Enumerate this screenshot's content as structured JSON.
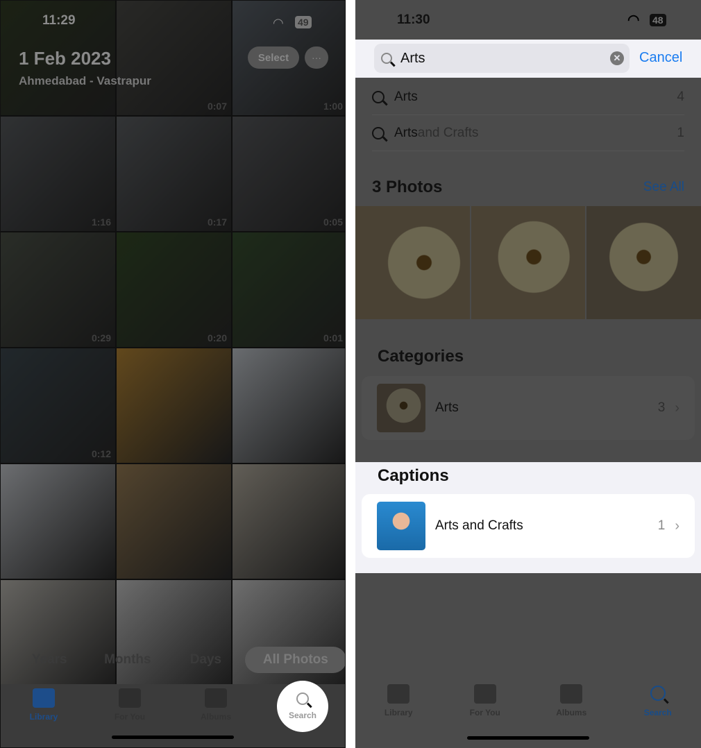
{
  "left": {
    "status": {
      "time": "11:29",
      "battery": "49"
    },
    "header": {
      "date": "1 Feb 2023",
      "location": "Ahmedabad - Vastrapur",
      "select_label": "Select",
      "more_label": "···"
    },
    "tiles": [
      {
        "duration": ""
      },
      {
        "duration": "0:07"
      },
      {
        "duration": "1:00"
      },
      {
        "duration": "1:16"
      },
      {
        "duration": "0:17"
      },
      {
        "duration": "0:05"
      },
      {
        "duration": "0:29"
      },
      {
        "duration": "0:20"
      },
      {
        "duration": "0:01"
      },
      {
        "duration": "0:12"
      },
      {
        "duration": ""
      },
      {
        "duration": ""
      },
      {
        "duration": ""
      },
      {
        "duration": ""
      },
      {
        "duration": ""
      },
      {
        "duration": ""
      },
      {
        "duration": ""
      },
      {
        "duration": ""
      }
    ],
    "segments": [
      "Years",
      "Months",
      "Days",
      "All Photos"
    ],
    "tabs": [
      "Library",
      "For You",
      "Albums",
      "Search"
    ]
  },
  "right": {
    "status": {
      "time": "11:30",
      "battery": "48"
    },
    "search": {
      "value": "Arts",
      "cancel_label": "Cancel"
    },
    "suggestions": [
      {
        "label": "Arts",
        "suffix": "",
        "count": "4"
      },
      {
        "label": "Arts",
        "suffix": " and Crafts",
        "count": "1"
      }
    ],
    "photos": {
      "title": "3 Photos",
      "see_all": "See All"
    },
    "categories": {
      "title": "Categories",
      "items": [
        {
          "label": "Arts",
          "count": "3"
        }
      ]
    },
    "captions": {
      "title": "Captions",
      "items": [
        {
          "label": "Arts and Crafts",
          "count": "1"
        }
      ]
    },
    "tabs": [
      "Library",
      "For You",
      "Albums",
      "Search"
    ]
  },
  "colors": {
    "accent": "#1a7cf0",
    "dim": "#4b4b4b",
    "highlight_bg": "#f2f2f7"
  }
}
